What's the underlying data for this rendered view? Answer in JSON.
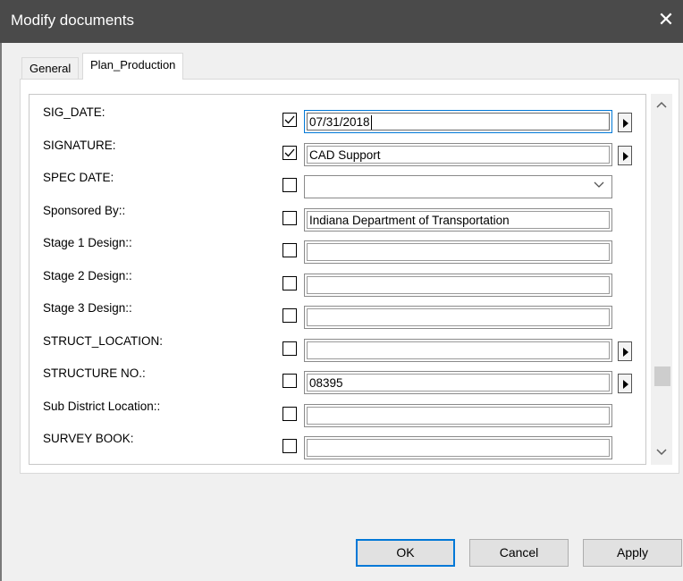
{
  "window": {
    "title": "Modify documents",
    "close_glyph": "✕"
  },
  "tabs": [
    {
      "label": "General",
      "active": false
    },
    {
      "label": "Plan_Production",
      "active": true
    }
  ],
  "rows": [
    {
      "label": "SIG_DATE:",
      "checked": true,
      "value": "07/31/2018",
      "control": "text",
      "arrow": true,
      "focused": true
    },
    {
      "label": "SIGNATURE:",
      "checked": true,
      "value": "CAD Support",
      "control": "text",
      "arrow": true
    },
    {
      "label": "SPEC DATE:",
      "checked": false,
      "value": "",
      "control": "combo",
      "arrow": false
    },
    {
      "label": "Sponsored By::",
      "checked": false,
      "value": "Indiana Department of Transportation",
      "control": "text",
      "arrow": false
    },
    {
      "label": "Stage 1 Design::",
      "checked": false,
      "value": "",
      "control": "text",
      "arrow": false
    },
    {
      "label": "Stage 2 Design::",
      "checked": false,
      "value": "",
      "control": "text",
      "arrow": false
    },
    {
      "label": "Stage 3 Design::",
      "checked": false,
      "value": "",
      "control": "text",
      "arrow": false
    },
    {
      "label": "STRUCT_LOCATION:",
      "checked": false,
      "value": "",
      "control": "text",
      "arrow": true
    },
    {
      "label": "STRUCTURE NO.:",
      "checked": false,
      "value": "08395",
      "control": "text",
      "arrow": true
    },
    {
      "label": "Sub District Location::",
      "checked": false,
      "value": "",
      "control": "text",
      "arrow": false
    },
    {
      "label": "SURVEY BOOK:",
      "checked": false,
      "value": "",
      "control": "text",
      "arrow": false
    }
  ],
  "scrollbar": {
    "position_fraction": 0.8
  },
  "buttons": {
    "ok": "OK",
    "cancel": "Cancel",
    "apply": "Apply"
  },
  "colors": {
    "title_bar": "#4a4a4a",
    "focus_accent": "#0078d7"
  }
}
